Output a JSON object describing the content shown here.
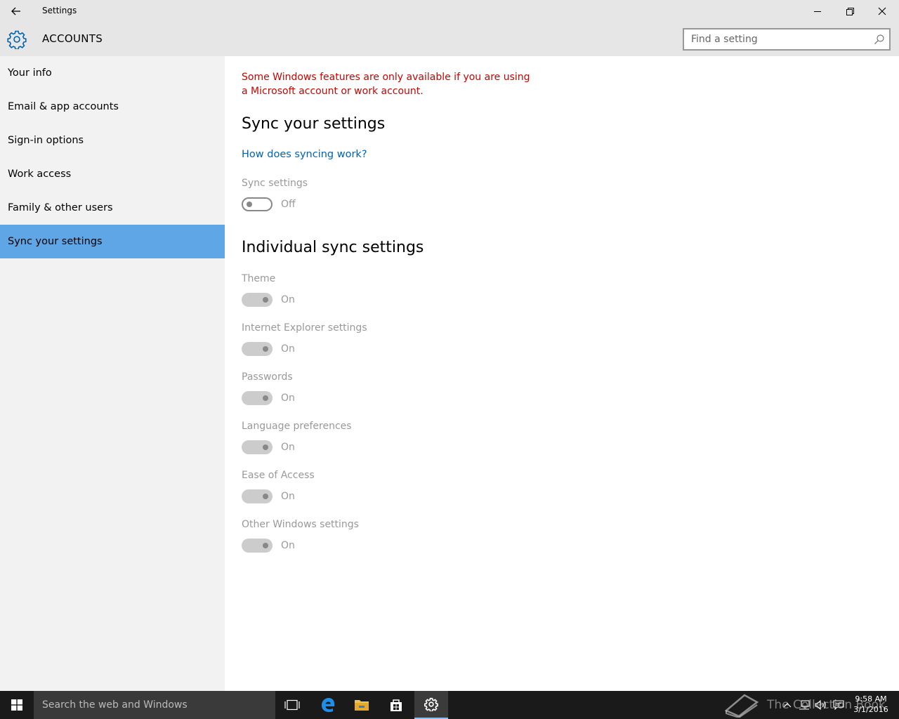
{
  "window": {
    "title": "Settings",
    "back_icon": "arrow-left-icon"
  },
  "header": {
    "title": "ACCOUNTS",
    "icon": "gear-icon",
    "accent": "#0063b1",
    "search_placeholder": "Find a setting"
  },
  "sidebar": {
    "items": [
      {
        "label": "Your info"
      },
      {
        "label": "Email & app accounts"
      },
      {
        "label": "Sign-in options"
      },
      {
        "label": "Work access"
      },
      {
        "label": "Family & other users"
      },
      {
        "label": "Sync your settings",
        "selected": true
      }
    ],
    "selected_color": "#5ea6e6"
  },
  "main": {
    "warning": "Some Windows features are only available if you are using a Microsoft account or work account.",
    "warning_color": "#c50500",
    "sync_heading": "Sync your settings",
    "help_link": "How does syncing work?",
    "sync_settings": {
      "label": "Sync settings",
      "state": "Off"
    },
    "individual_heading": "Individual sync settings",
    "individual": [
      {
        "label": "Theme",
        "state": "On"
      },
      {
        "label": "Internet Explorer settings",
        "state": "On"
      },
      {
        "label": "Passwords",
        "state": "On"
      },
      {
        "label": "Language preferences",
        "state": "On"
      },
      {
        "label": "Ease of Access",
        "state": "On"
      },
      {
        "label": "Other Windows settings",
        "state": "On"
      }
    ]
  },
  "taskbar": {
    "search_text": "Search the web and Windows",
    "watermark": "The Collection Book",
    "time": "9:58 AM",
    "date": "3/1/2016"
  }
}
